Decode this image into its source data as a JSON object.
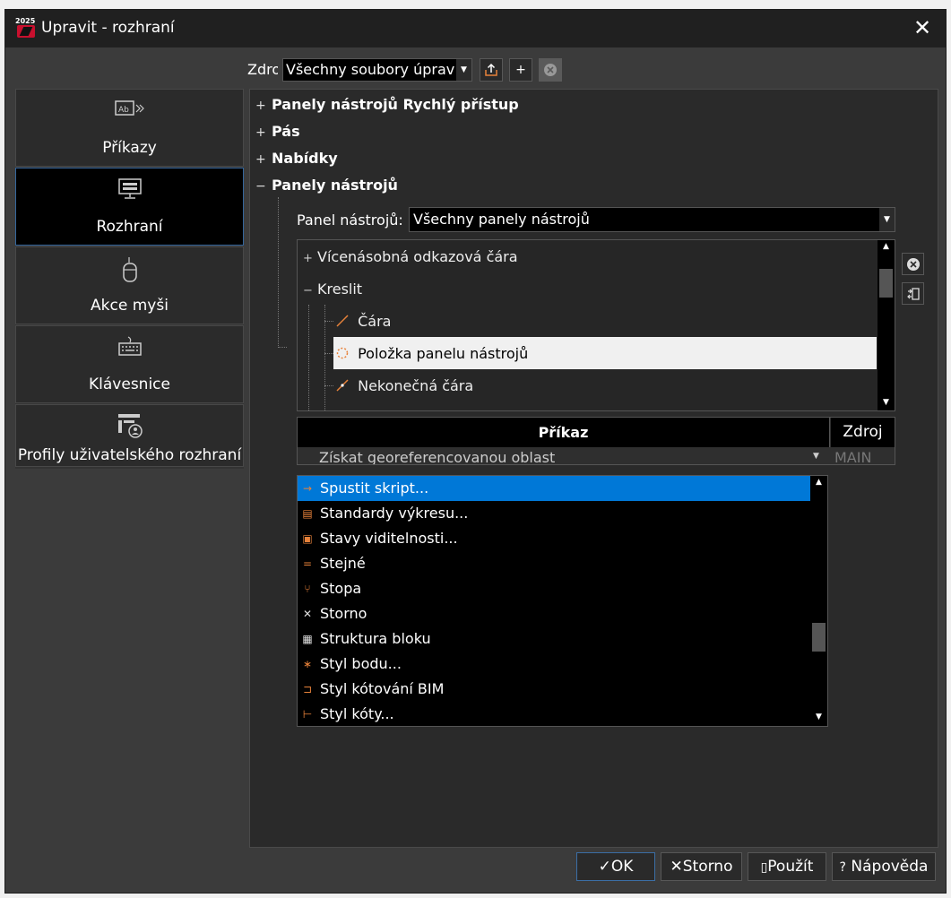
{
  "window": {
    "title": "Upravit - rozhraní",
    "app_icon_year": "2025"
  },
  "source": {
    "label": "Zdroj",
    "value": "Všechny soubory úprav",
    "buttons": [
      "export-icon",
      "add-icon",
      "remove-icon"
    ],
    "add_label": "+"
  },
  "nav": {
    "items": [
      {
        "label": "Příkazy",
        "icon": "commands-icon"
      },
      {
        "label": "Rozhraní",
        "icon": "interface-icon",
        "active": true
      },
      {
        "label": "Akce myši",
        "icon": "mouse-icon"
      },
      {
        "label": "Klávesnice",
        "icon": "keyboard-icon"
      },
      {
        "label": "Profily uživatelského rozhraní",
        "icon": "profiles-icon"
      }
    ]
  },
  "tree": {
    "sections": [
      {
        "label": "Panely nástrojů Rychlý přístup",
        "expanded": false,
        "marker": "+"
      },
      {
        "label": "Pás",
        "expanded": false,
        "marker": "+"
      },
      {
        "label": "Nabídky",
        "expanded": false,
        "marker": "+"
      },
      {
        "label": "Panely nástrojů",
        "expanded": true,
        "marker": "−"
      }
    ]
  },
  "toolbar_panel": {
    "label": "Panel nástrojů:",
    "value": "Všechny panely nástrojů",
    "items": [
      {
        "label": "Vícenásobná odkazová čára",
        "marker": "+"
      },
      {
        "label": "Kreslit",
        "marker": "−"
      },
      {
        "label": "Čára",
        "icon": "line-icon"
      },
      {
        "label": "Položka panelu nástrojů",
        "icon": "toolbar-item-icon",
        "selected": true
      },
      {
        "label": "Nekonečná čára",
        "icon": "xline-icon"
      }
    ]
  },
  "grid": {
    "headers": [
      "Příkaz",
      "Zdroj"
    ],
    "row": {
      "command": "Získat georeferencovanou oblast",
      "source": "MAIN"
    }
  },
  "dropdown": {
    "items": [
      {
        "label": "Spustit skript...",
        "icon": "run-script-icon",
        "selected": true
      },
      {
        "label": "Standardy výkresu...",
        "icon": "drawing-standards-icon"
      },
      {
        "label": "Stavy viditelnosti...",
        "icon": "visibility-states-icon"
      },
      {
        "label": "Stejné",
        "icon": "same-icon"
      },
      {
        "label": "Stopa",
        "icon": "trace-icon"
      },
      {
        "label": "Storno",
        "icon": "cancel-icon"
      },
      {
        "label": "Struktura bloku",
        "icon": "block-structure-icon"
      },
      {
        "label": "Styl bodu...",
        "icon": "point-style-icon"
      },
      {
        "label": "Styl kótování BIM",
        "icon": "bim-dimension-style-icon"
      },
      {
        "label": "Styl kóty...",
        "icon": "dimension-style-icon"
      }
    ]
  },
  "footer": {
    "ok": "OK",
    "cancel": "Storno",
    "apply": "Použít",
    "help": "Nápověda"
  },
  "colors": {
    "accent": "#0078d7",
    "selection": "#f0f0f0",
    "background": "#3b3b3b"
  }
}
